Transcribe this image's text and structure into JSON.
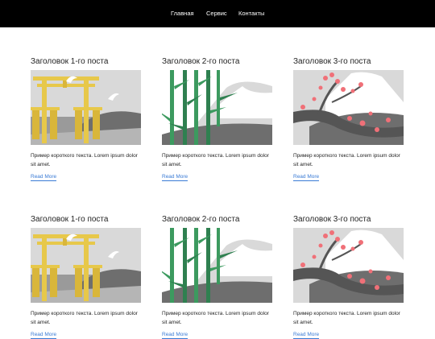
{
  "nav": {
    "items": [
      "Главная",
      "Сервис",
      "Контакты"
    ]
  },
  "posts": [
    {
      "title": "Заголовок 1-го поста",
      "text": "Пример короткого текста. Lorem ipsum dolor sit amet.",
      "link": "Read More",
      "image": "torii-gate-illustration"
    },
    {
      "title": "Заголовок 2-го поста",
      "text": "Пример короткого текста. Lorem ipsum dolor sit amet.",
      "link": "Read More",
      "image": "bamboo-illustration"
    },
    {
      "title": "Заголовок 3-го поста",
      "text": "Пример короткого текста. Lorem ipsum dolor sit amet.",
      "link": "Read More",
      "image": "sakura-branch-illustration"
    },
    {
      "title": "Заголовок 1-го поста",
      "text": "Пример короткого текста. Lorem ipsum dolor sit amet.",
      "link": "Read More",
      "image": "torii-gate-illustration"
    },
    {
      "title": "Заголовок 2-го поста",
      "text": "Пример короткого текста. Lorem ipsum dolor sit amet.",
      "link": "Read More",
      "image": "bamboo-illustration"
    },
    {
      "title": "Заголовок 3-го поста",
      "text": "Пример короткого текста. Lorem ipsum dolor sit amet.",
      "link": "Read More",
      "image": "sakura-branch-illustration"
    }
  ],
  "colors": {
    "header_bg": "#000000",
    "link": "#3a7bd5",
    "torii": "#e7c84a",
    "bamboo": "#3c9a5f",
    "sakura": "#f07078"
  }
}
